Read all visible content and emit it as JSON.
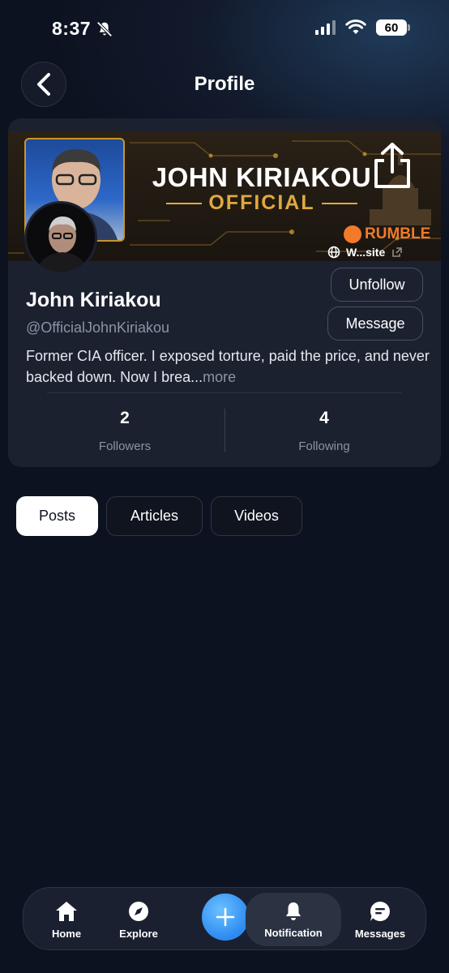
{
  "status_bar": {
    "time": "8:37",
    "battery": "60"
  },
  "header": {
    "title": "Profile"
  },
  "banner": {
    "title": "JOHN KIRIAKOU",
    "subtitle": "OFFICIAL",
    "badge": "RUMBLE",
    "website_label": "W...site"
  },
  "profile": {
    "name": "John Kiriakou",
    "handle": "@OfficialJohnKiriakou",
    "bio": "Former CIA officer. I exposed torture, paid the price, and never backed down. Now I brea...",
    "more_label": "more",
    "unfollow_label": "Unfollow",
    "message_label": "Message",
    "followers_count": "2",
    "followers_label": "Followers",
    "following_count": "4",
    "following_label": "Following"
  },
  "tabs": [
    {
      "label": "Posts",
      "active": true
    },
    {
      "label": "Articles",
      "active": false
    },
    {
      "label": "Videos",
      "active": false
    }
  ],
  "bottom_nav": {
    "items": [
      {
        "label": "Home",
        "icon": "home-icon"
      },
      {
        "label": "Explore",
        "icon": "compass-icon"
      },
      {
        "label": "Notification",
        "icon": "bell-icon"
      },
      {
        "label": "Messages",
        "icon": "chat-icon"
      }
    ]
  },
  "colors": {
    "background": "#0d1220",
    "card": "#1c2130",
    "accent": "#2c8af0",
    "gold": "#e0a93d",
    "rumble": "#f27a2a"
  }
}
